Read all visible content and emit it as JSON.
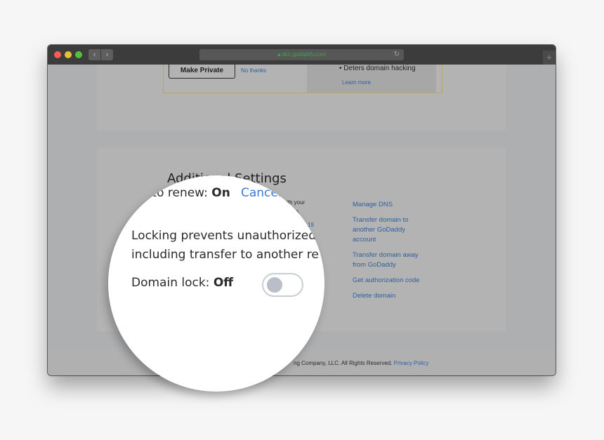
{
  "browser": {
    "url": "dcc.godaddy.com",
    "lock_icon": "lock-icon",
    "reload_icon": "reload-icon",
    "new_tab_icon": "plus-icon",
    "traffic_colors": {
      "close": "#fc5b57",
      "minimize": "#e5bf3c",
      "zoom": "#57c038"
    }
  },
  "privacy_promo": {
    "make_private_label": "Make Private",
    "no_thanks_label": "No thanks",
    "bullet": "Deters domain hacking",
    "learn_more_label": "Learn more"
  },
  "settings": {
    "title": "Additional Settings",
    "auto_renew_label": "Auto renew:",
    "auto_renew_value": "On",
    "cancel_label": "Cancel",
    "partial_text_1": "ith your",
    "partial_text_2": "ain.",
    "partial_text_3": "19",
    "lock_description_line1": "Locking prevents unauthorized",
    "lock_description_line2": "including transfer to another re",
    "domain_lock_label": "Domain lock:",
    "domain_lock_value": "Off",
    "domain_lock_enabled": false
  },
  "side_links": [
    "Manage DNS",
    "Transfer domain to another GoDaddy account",
    "Transfer domain away from GoDaddy",
    "Get authorization code",
    "Delete domain"
  ],
  "footer": {
    "copyright": "ng Company, LLC. All Rights Reserved.",
    "privacy_label": "Privacy Policy"
  }
}
